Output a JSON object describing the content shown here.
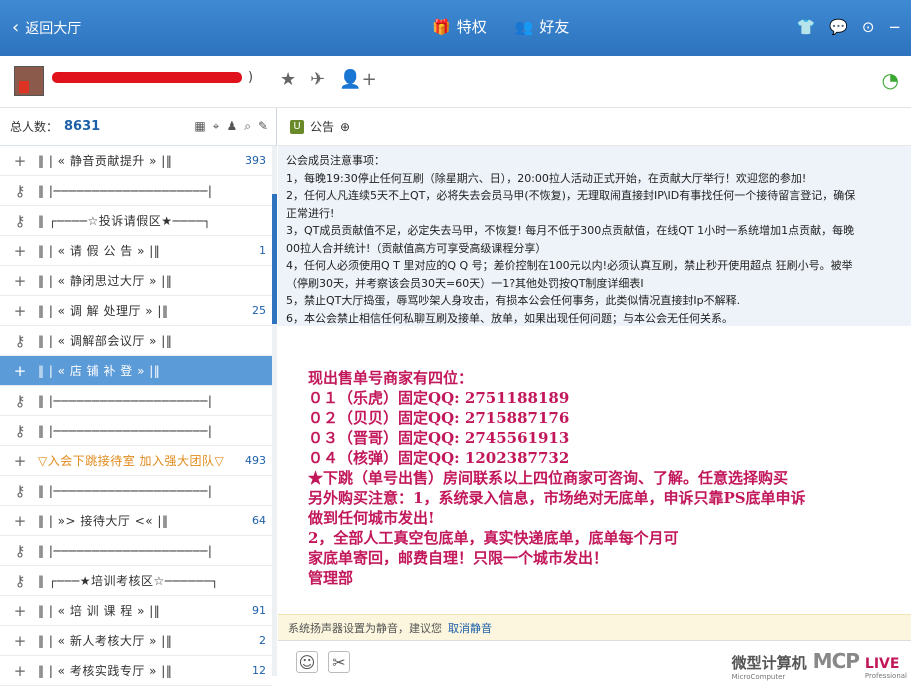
{
  "topbar": {
    "back_label": "返回大厅",
    "privilege_label": "特权",
    "friends_label": "好友",
    "right_icons": [
      "shirt-icon",
      "chat-icon",
      "settings-icon",
      "minimize-icon"
    ]
  },
  "room": {
    "name_suffix": ")",
    "icons": [
      "star-icon",
      "plane-icon",
      "add-user-icon"
    ]
  },
  "left": {
    "total_label": "总人数：",
    "total_value": "8631",
    "channels": [
      {
        "icon": "+",
        "name": "‖ |    «   静音贡献提升   »    |‖",
        "count": "393",
        "sel": false,
        "orange": false
      },
      {
        "icon": "key",
        "name": "‖ |────────────────────|",
        "count": "",
        "sel": false,
        "orange": false
      },
      {
        "icon": "key",
        "name": "‖ ┌────☆投诉请假区★────┐",
        "count": "",
        "sel": false,
        "orange": false
      },
      {
        "icon": "+",
        "name": "‖ |    «  请 假 公 告   »    |‖",
        "count": "1",
        "sel": false,
        "orange": false
      },
      {
        "icon": "+",
        "name": "‖ |    «   静闭思过大厅   »   |‖",
        "count": "",
        "sel": false,
        "orange": false
      },
      {
        "icon": "+",
        "name": "‖ |    «  调 解 处理厅   »   |‖",
        "count": "25",
        "sel": false,
        "orange": false
      },
      {
        "icon": "key",
        "name": "‖ |    «   调解部会议厅   »   |‖",
        "count": "",
        "sel": false,
        "orange": false
      },
      {
        "icon": "+",
        "name": "‖ |    «  店 铺 补 登   »    |‖",
        "count": "",
        "sel": true,
        "orange": false
      },
      {
        "icon": "key",
        "name": "‖ |────────────────────|",
        "count": "",
        "sel": false,
        "orange": false
      },
      {
        "icon": "key",
        "name": "‖ |────────────────────|",
        "count": "",
        "sel": false,
        "orange": false
      },
      {
        "icon": "+",
        "name": "▽入会下跳接待室  加入强大团队▽",
        "count": "493",
        "sel": false,
        "orange": true
      },
      {
        "icon": "key",
        "name": "‖ |────────────────────|",
        "count": "",
        "sel": false,
        "orange": false
      },
      {
        "icon": "+",
        "name": "‖ |  »>           接待大厅 <«  |‖",
        "count": "64",
        "sel": false,
        "orange": false
      },
      {
        "icon": "key",
        "name": "‖ |────────────────────|",
        "count": "",
        "sel": false,
        "orange": false
      },
      {
        "icon": "key",
        "name": "‖ ┌───★培训考核区☆──────┐",
        "count": "",
        "sel": false,
        "orange": false
      },
      {
        "icon": "+",
        "name": "‖ |    «  培 训  课 程   »    |‖",
        "count": "91",
        "sel": false,
        "orange": false
      },
      {
        "icon": "+",
        "name": "‖ |    «   新人考核大厅   »   |‖",
        "count": "2",
        "sel": false,
        "orange": false
      },
      {
        "icon": "+",
        "name": "‖ |    «   考核实践专厅   »   |‖",
        "count": "12",
        "sel": false,
        "orange": false
      }
    ]
  },
  "right": {
    "announcement_title": "公告",
    "announcement_lines": [
      "公会成员注意事项：",
      "  1，每晚19:30停止任何互刷（除星期六、日），20:00拉人活动正式开始，在贡献大厅举行！欢迎您的参加!",
      "  2，任何人凡连续5天不上QT，必将失去会员马甲(不恢复)，无理取闹直接封IP\\ID有事找任何一个接待留言登记，确保",
      "正常进行!",
      "  3，QT成员贡献值不足，必定失去马甲，不恢复!  每月不低于300点贡献值，在线QT 1小时一系统增加1点贡献，每晚",
      "00拉人合并统计!（贡献值高方可享受高级课程分享）",
      "  4，任何人必须使用Q T 里对应的Q Q 号；差价控制在100元以内!必须认真互刷，禁止秒开使用超点 狂刷小号。被举",
      "（停刷30天，并考察该会员30天=60天）一1?其他处罚按QT制度详细表I",
      "  5，禁止QT大厅捣蛋，辱骂吵架人身攻击，有损本公会任何事务，此类似情况直接封Ip不解释.",
      "  6，本公会禁止相信任何私聊互刷及接单、放单，如果出现任何问题；与本公会无任何关系。"
    ],
    "notice_lines": [
      "现出售单号商家有四位：",
      "      ０１（乐虎）固定QQ: 2751188189",
      "      ０２（贝贝）固定QQ: 2715887176",
      "      ０３（晋哥）固定QQ: 2745561913",
      "      ０４（核弹）固定QQ: 1202387732",
      "★下跳（单号出售）房间联系以上四位商家可咨询、了解。任意选择购买",
      "另外购买注意：1，系统录入信息，市场绝对无底单，申诉只靠PS底单申诉",
      "做到任何城市发出!",
      "                2，全部人工真空包底单，真实快递底单，底单每个月可",
      "家底单寄回，邮费自理！只限一个城市发出！",
      "                                  管理部"
    ],
    "sound_text": "系统扬声器设置为静音，建议您",
    "sound_link": "取消静音",
    "watermark_cn": "微型计算机",
    "watermark_en": "MicroComputer",
    "watermark_mcp": "MCP",
    "watermark_live": "LIVE",
    "watermark_pro": "Professional"
  },
  "colors": {
    "topbar": "#2d73bd",
    "selected": "#5b9bd8",
    "notice": "#c2185b",
    "redact": "#e0121c"
  }
}
